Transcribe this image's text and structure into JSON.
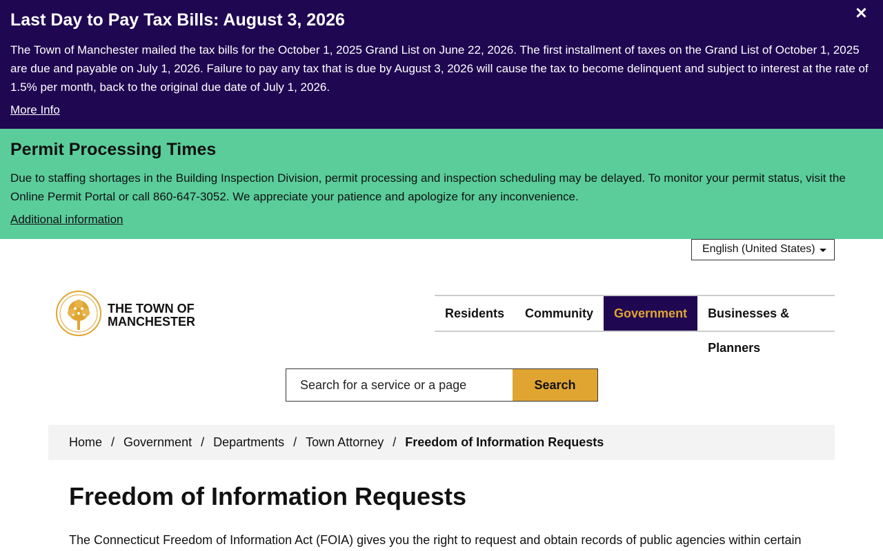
{
  "alerts": {
    "tax": {
      "title": "Last Day to Pay Tax Bills: August 3, 2026",
      "body": "The Town of Manchester mailed the tax bills for the October 1, 2025 Grand List on June 22, 2026. The first installment of taxes on the Grand List of October 1, 2025 are due and payable on July 1, 2026. Failure to pay any tax that is due by August 3, 2026 will cause the tax to become delinquent and subject to interest at the rate of 1.5% per month, back to the original due date of July 1, 2026.",
      "link": "More Info",
      "bg_color": "#1f0752"
    },
    "permit": {
      "title": "Permit Processing Times",
      "body": "Due to staffing shortages in the Building Inspection Division, permit processing and inspection scheduling may be delayed. To monitor your permit status, visit the Online Permit Portal or call 860-647-3052. We appreciate your patience and apologize for any inconvenience.",
      "link": "Additional information",
      "bg_color": "#5acd9b"
    }
  },
  "language": {
    "selected": "English (United States)"
  },
  "logo": {
    "line1": "THE TOWN OF",
    "line2": "MANCHESTER",
    "icon": "town-seal-icon"
  },
  "nav": {
    "items": [
      {
        "label": "Residents",
        "active": false
      },
      {
        "label": "Community",
        "active": false
      },
      {
        "label": "Government",
        "active": true
      },
      {
        "label": "Businesses & Planners",
        "active": false
      }
    ],
    "active_bg": "#1f0752",
    "active_fg": "#e0a531"
  },
  "search": {
    "placeholder": "Search for a service or a page",
    "button": "Search",
    "button_color": "#e0a531"
  },
  "breadcrumb": {
    "items": [
      "Home",
      "Government",
      "Departments",
      "Town Attorney"
    ],
    "current": "Freedom of Information Requests",
    "separator": "/"
  },
  "page": {
    "title": "Freedom of Information Requests",
    "intro": "The Connecticut Freedom of Information Act (FOIA) gives you the right to request and obtain records of public agencies within certain"
  }
}
